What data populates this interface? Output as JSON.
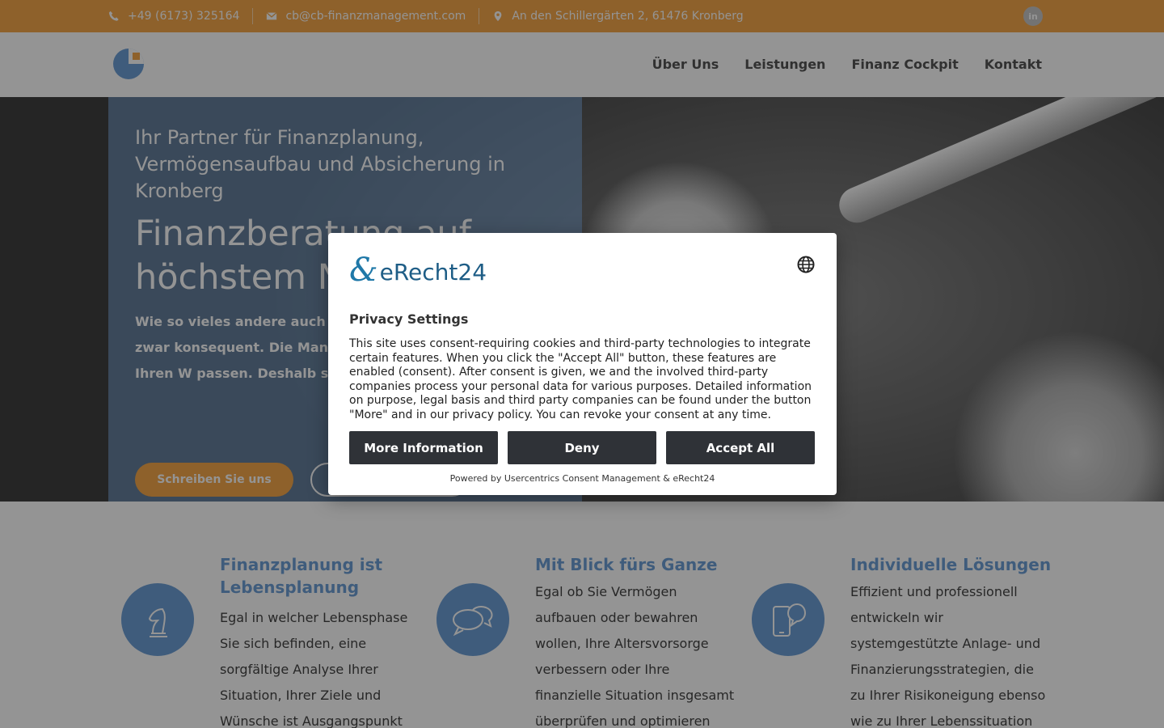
{
  "topbar": {
    "phone": "+49 (6173) 325164",
    "email": "cb@cb-finanzmanagement.com",
    "address": "An den Schillergärten 2, 61476 Kronberg",
    "social_label": "in",
    "color": "#f5a84a"
  },
  "nav": {
    "items": [
      {
        "label": "Über Uns"
      },
      {
        "label": "Leistungen"
      },
      {
        "label": "Finanz Cockpit"
      },
      {
        "label": "Kontakt"
      }
    ]
  },
  "hero": {
    "subtitle": "Ihr Partner für Finanzplanung, Vermögensaufbau und Absicherung in Kronberg",
    "title": "Finanzberatung auf höchstem Niveau",
    "text": "Wie so vieles andere auch muss sein Bestes zu geben, und zwar konsequent. Die Management zu entwickeln, die zu Ihren W passen. Deshalb stehen Sie be",
    "primary_button": "Schreiben Sie uns"
  },
  "features": [
    {
      "icon": "chess-knight-icon",
      "title": "Finanzplanung ist Lebensplanung",
      "text": "Egal in welcher Lebensphase Sie sich befinden, eine sorgfältige Analyse Ihrer Situation, Ihrer Ziele und Wünsche ist Ausgangspunkt für"
    },
    {
      "icon": "speech-bubbles-icon",
      "title": "Mit Blick fürs Ganze",
      "text": "Egal ob Sie Vermögen aufbauen oder bewahren wollen, Ihre Altersvorsorge verbessern oder Ihre finanzielle Situation insgesamt überprüfen und optimieren möchten. Wir"
    },
    {
      "icon": "phone-chat-icon",
      "title": "Individuelle Lösungen",
      "text": "Effizient und professionell entwickeln wir systemgestützte Anlage- und Finanzierungsstrategien, die zu Ihrer Risikoneigung ebenso wie zu Ihrer Lebenssituation"
    }
  ],
  "colors": {
    "accent_blue": "#6d9fd6",
    "button_dark": "#2f3237"
  },
  "consent": {
    "brand": "eRecht24",
    "title": "Privacy Settings",
    "text": "This site uses consent-requiring cookies and third-party technologies to integrate certain features. When you click the \"Accept All\" button, these features are enabled (consent). After consent is given, we and the involved third-party companies process your personal data for various purposes. Detailed information on purpose, legal basis and third party companies can be found under the button \"More\" and in our privacy policy. You can revoke your consent at any time.",
    "buttons": {
      "more": "More Information",
      "deny": "Deny",
      "accept": "Accept All"
    },
    "footer": "Powered by Usercentrics Consent Management & eRecht24"
  }
}
